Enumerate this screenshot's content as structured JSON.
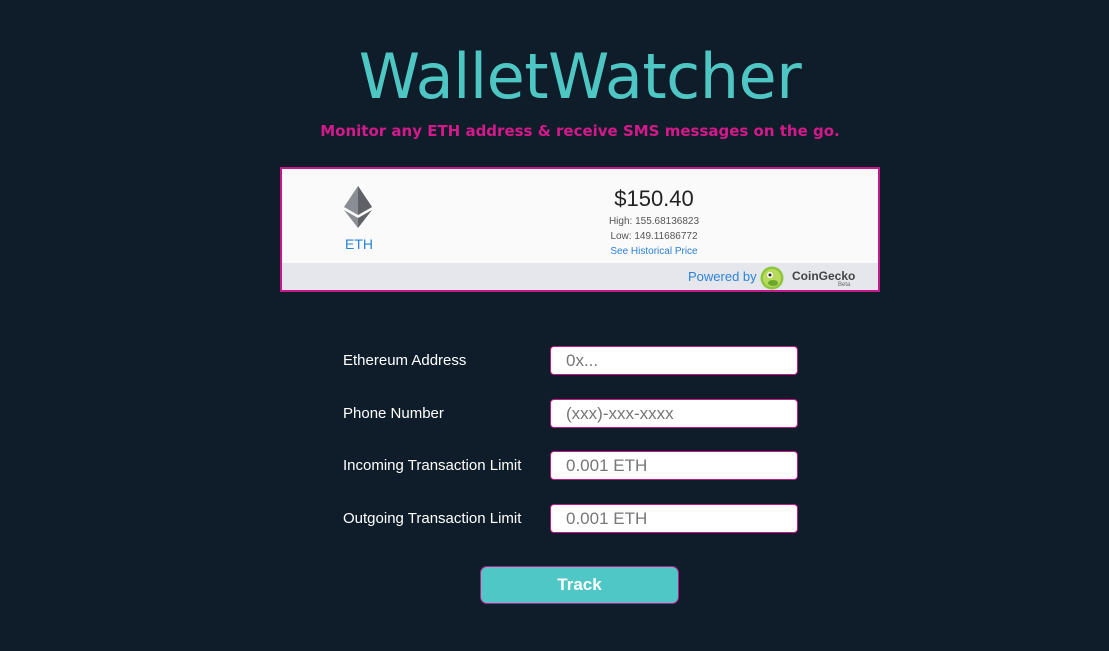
{
  "header": {
    "title": "WalletWatcher",
    "subtitle": "Monitor any ETH address & receive SMS messages on the go."
  },
  "price_widget": {
    "coin_icon": "ethereum-icon",
    "coin_symbol": "ETH",
    "price": "$150.40",
    "high": "High: 155.68136823",
    "low": "Low: 149.11686772",
    "history_link": "See Historical Price",
    "powered_by": "Powered by",
    "provider_icon": "coingecko-icon",
    "provider_name": "CoinGecko",
    "provider_tag": "Beta"
  },
  "form": {
    "fields": [
      {
        "label": "Ethereum Address",
        "placeholder": "0x...",
        "value": ""
      },
      {
        "label": "Phone Number",
        "placeholder": "(xxx)-xxx-xxxx",
        "value": ""
      },
      {
        "label": "Incoming Transaction Limit",
        "placeholder": "0.001 ETH",
        "value": ""
      },
      {
        "label": "Outgoing Transaction Limit",
        "placeholder": "0.001 ETH",
        "value": ""
      }
    ],
    "submit_label": "Track"
  },
  "colors": {
    "background": "#0f1d2a",
    "accent_teal": "#4ec7c4",
    "accent_magenta": "#d4198a",
    "link_blue": "#2a84d6"
  }
}
